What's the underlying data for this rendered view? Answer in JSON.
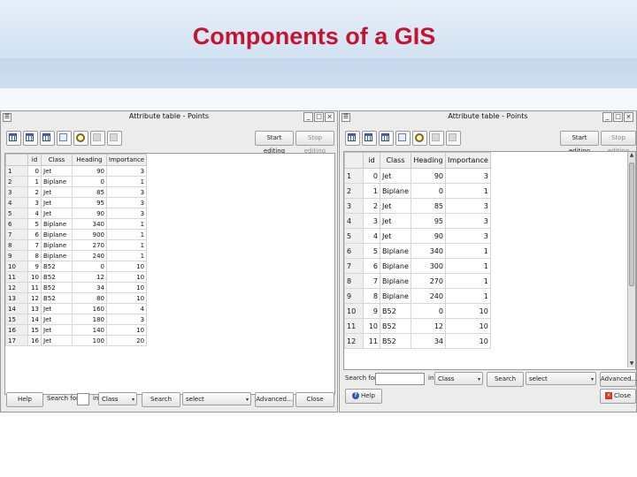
{
  "slide": {
    "title": "Components of a GIS"
  },
  "colors": {
    "title": "#c41432",
    "header_top": "#e6eff8",
    "header_band": "#c3d7ec"
  },
  "left_window": {
    "title": "Attribute table - Points",
    "menu_glyph": "☰",
    "win_buttons": [
      "_",
      "□",
      "×"
    ],
    "toolbar_icons": [
      "table-grid-icon",
      "select-all-icon",
      "invert-selection-icon",
      "move-to-top-icon",
      "zoom-to-selection-icon",
      "copy-icon",
      "delete-icon"
    ],
    "start_editing": "Start editing",
    "stop_editing": "Stop editing",
    "columns": [
      "id",
      "Class",
      "Heading",
      "Importance"
    ],
    "rows": [
      [
        "1",
        "0",
        "Jet",
        "90",
        "3"
      ],
      [
        "2",
        "1",
        "Biplane",
        "0",
        "1"
      ],
      [
        "3",
        "2",
        "Jet",
        "85",
        "3"
      ],
      [
        "4",
        "3",
        "Jet",
        "95",
        "3"
      ],
      [
        "5",
        "4",
        "Jet",
        "90",
        "3"
      ],
      [
        "6",
        "5",
        "Biplane",
        "340",
        "1"
      ],
      [
        "7",
        "6",
        "Biplane",
        "900",
        "1"
      ],
      [
        "8",
        "7",
        "Biplane",
        "270",
        "1"
      ],
      [
        "9",
        "8",
        "Biplane",
        "240",
        "1"
      ],
      [
        "10",
        "9",
        "B52",
        "0",
        "10"
      ],
      [
        "11",
        "10",
        "B52",
        "12",
        "10"
      ],
      [
        "12",
        "11",
        "B52",
        "34",
        "10"
      ],
      [
        "13",
        "12",
        "B52",
        "80",
        "10"
      ],
      [
        "14",
        "13",
        "Jet",
        "160",
        "4"
      ],
      [
        "15",
        "14",
        "Jet",
        "180",
        "3"
      ],
      [
        "16",
        "15",
        "Jet",
        "140",
        "10"
      ],
      [
        "17",
        "16",
        "Jet",
        "100",
        "20"
      ]
    ],
    "help": "Help",
    "search_for": "Search for:",
    "in": "in",
    "field_combo": "Class",
    "search_button": "Search",
    "select_combo": "select",
    "advanced": "Advanced...",
    "close": "Close"
  },
  "right_window": {
    "title": "Attribute table - Points",
    "menu_glyph": "☰",
    "win_buttons": [
      "_",
      "□",
      "×"
    ],
    "toolbar_icons": [
      "table-grid-icon",
      "select-all-icon",
      "invert-selection-icon",
      "move-to-top-icon",
      "zoom-to-selection-icon",
      "copy-icon",
      "delete-icon"
    ],
    "start_editing": "Start editing",
    "stop_editing": "Stop editing",
    "columns": [
      "id",
      "Class",
      "Heading",
      "Importance"
    ],
    "rows": [
      [
        "1",
        "0",
        "Jet",
        "90",
        "3"
      ],
      [
        "2",
        "1",
        "Biplane",
        "0",
        "1"
      ],
      [
        "3",
        "2",
        "Jet",
        "85",
        "3"
      ],
      [
        "4",
        "3",
        "Jet",
        "95",
        "3"
      ],
      [
        "5",
        "4",
        "Jet",
        "90",
        "3"
      ],
      [
        "6",
        "5",
        "Biplane",
        "340",
        "1"
      ],
      [
        "7",
        "6",
        "Biplane",
        "300",
        "1"
      ],
      [
        "8",
        "7",
        "Biplane",
        "270",
        "1"
      ],
      [
        "9",
        "8",
        "Biplane",
        "240",
        "1"
      ],
      [
        "10",
        "9",
        "B52",
        "0",
        "10"
      ],
      [
        "11",
        "10",
        "B52",
        "12",
        "10"
      ],
      [
        "12",
        "11",
        "B52",
        "34",
        "10"
      ]
    ],
    "search_for": "Search for",
    "in": "in",
    "field_combo": "Class",
    "search_button": "Search",
    "select_combo": "select",
    "advanced": "Advanced...",
    "help": "Help",
    "close": "Close"
  }
}
